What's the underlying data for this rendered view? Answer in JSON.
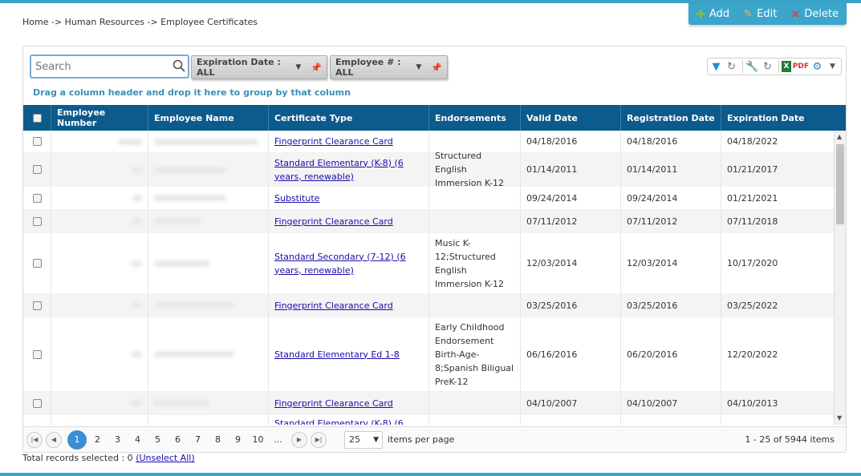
{
  "breadcrumb": "Home -> Human Resources -> Employee Certificates",
  "actions": {
    "add": "Add",
    "edit": "Edit",
    "delete": "Delete"
  },
  "search": {
    "placeholder": "Search",
    "value": ""
  },
  "filters": [
    {
      "label": "Expiration Date : ALL"
    },
    {
      "label": "Employee # : ALL"
    }
  ],
  "group_message": "Drag a column header and drop it here to group by that column",
  "columns": [
    "Employee Number",
    "Employee Name",
    "Certificate Type",
    "Endorsements",
    "Valid Date",
    "Registration Date",
    "Expiration Date"
  ],
  "rows": [
    {
      "certificate": "Fingerprint Clearance Card",
      "endorsements": "",
      "valid": "04/18/2016",
      "registration": "04/18/2016",
      "expiration": "04/18/2022"
    },
    {
      "certificate": "Standard Elementary (K-8) (6 years, renewable)",
      "endorsements": "Structured English Immersion K-12",
      "valid": "01/14/2011",
      "registration": "01/14/2011",
      "expiration": "01/21/2017"
    },
    {
      "certificate": "Substitute",
      "endorsements": "",
      "valid": "09/24/2014",
      "registration": "09/24/2014",
      "expiration": "01/21/2021"
    },
    {
      "certificate": "Fingerprint Clearance Card",
      "endorsements": "",
      "valid": "07/11/2012",
      "registration": "07/11/2012",
      "expiration": "07/11/2018"
    },
    {
      "certificate": "Standard Secondary (7-12) (6 years, renewable)",
      "endorsements": "Music K-12;Structured English Immersion K-12",
      "valid": "12/03/2014",
      "registration": "12/03/2014",
      "expiration": "10/17/2020"
    },
    {
      "certificate": "Fingerprint Clearance Card",
      "endorsements": "",
      "valid": "03/25/2016",
      "registration": "03/25/2016",
      "expiration": "03/25/2022"
    },
    {
      "certificate": "Standard Elementary Ed 1-8",
      "endorsements": "Early Childhood Endorsement Birth-Age-8;Spanish Biligual PreK-12",
      "valid": "06/16/2016",
      "registration": "06/20/2016",
      "expiration": "12/20/2022"
    },
    {
      "certificate": "Fingerprint Clearance Card",
      "endorsements": "",
      "valid": "04/10/2007",
      "registration": "04/10/2007",
      "expiration": "04/10/2013"
    },
    {
      "certificate": "Standard Elementary (K-8) (6",
      "endorsements": "",
      "valid": "",
      "registration": "",
      "expiration": ""
    }
  ],
  "pager": {
    "pages": [
      "1",
      "2",
      "3",
      "4",
      "5",
      "6",
      "7",
      "8",
      "9",
      "10",
      "..."
    ],
    "page_size": "25",
    "items_per_page": "items per page",
    "info": "1 - 25 of 5944 items"
  },
  "selection": {
    "text": "Total records selected : 0",
    "unselect": "(Unselect All)"
  }
}
